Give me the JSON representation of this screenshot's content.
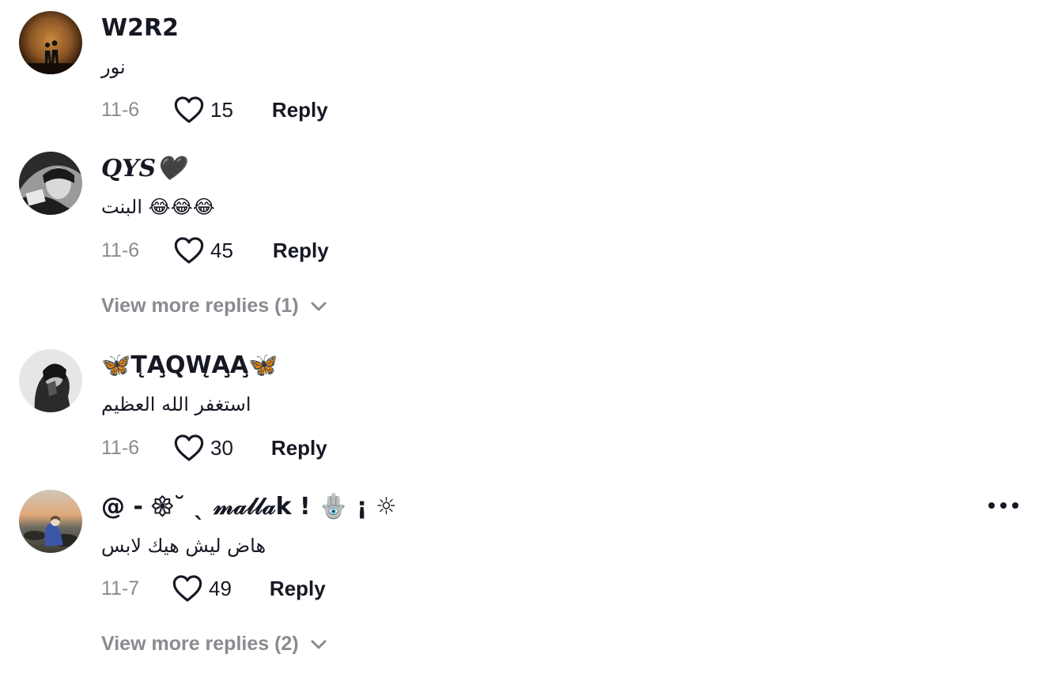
{
  "comments": [
    {
      "username": "W2R2",
      "text": "نور",
      "date": "11-6",
      "likes": "15",
      "reply_label": "Reply"
    },
    {
      "username": "𝑸𝒀𝑺🖤",
      "text": "البنت 😂😂😂",
      "date": "11-6",
      "likes": "45",
      "reply_label": "Reply",
      "view_more": "View more replies (1)"
    },
    {
      "username": "🦋T̨A̧Q̨W̨A̧A̧🦋",
      "text": "استغفر الله العظيم",
      "date": "11-6",
      "likes": "30",
      "reply_label": "Reply"
    },
    {
      "username": "@ - 𑁍˘  ˎ 𝓂𝒶𝓁𝓁𝒶k ! 🪬 ¡ ☼",
      "text": "هاض ليش هيك لابس",
      "date": "11-7",
      "likes": "49",
      "reply_label": "Reply",
      "view_more": "View more replies (2)"
    }
  ],
  "icons": {
    "like": "heart-outline-icon",
    "expand": "chevron-down-icon",
    "more": "more-options-icon"
  },
  "colors": {
    "text_primary": "#161823",
    "text_secondary": "#8a8b91"
  }
}
